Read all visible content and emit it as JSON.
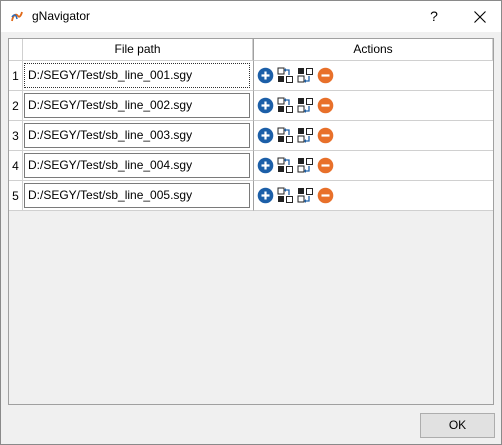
{
  "window": {
    "title": "gNavigator",
    "help_label": "?",
    "icon": "app-logo-icon"
  },
  "table": {
    "columns": [
      "File path",
      "Actions"
    ],
    "rows": [
      {
        "index": "1",
        "path": "D:/SEGY/Test/sb_line_001.sgy"
      },
      {
        "index": "2",
        "path": "D:/SEGY/Test/sb_line_002.sgy"
      },
      {
        "index": "3",
        "path": "D:/SEGY/Test/sb_line_003.sgy"
      },
      {
        "index": "4",
        "path": "D:/SEGY/Test/sb_line_004.sgy"
      },
      {
        "index": "5",
        "path": "D:/SEGY/Test/sb_line_005.sgy"
      }
    ],
    "action_icons": [
      "add-icon",
      "move-up-icon",
      "move-down-icon",
      "remove-icon"
    ],
    "colors": {
      "add": "#1c5fa8",
      "remove": "#e8702a"
    }
  },
  "footer": {
    "ok_label": "OK"
  }
}
